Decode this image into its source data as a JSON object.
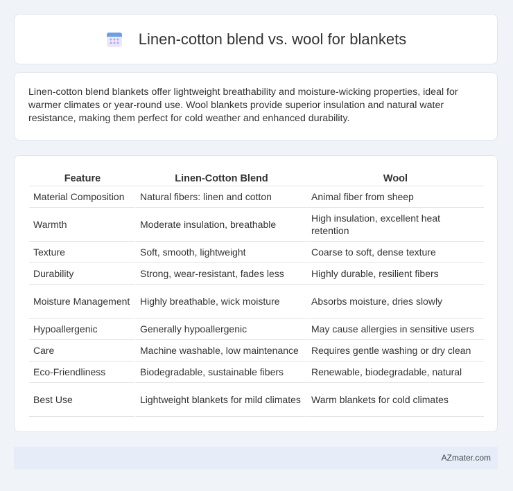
{
  "header": {
    "title": "Linen-cotton blend vs. wool for blankets",
    "icon": "calendar-icon"
  },
  "intro": {
    "text": "Linen-cotton blend blankets offer lightweight breathability and moisture-wicking properties, ideal for warmer climates or year-round use. Wool blankets provide superior insulation and natural water resistance, making them perfect for cold weather and enhanced durability."
  },
  "table": {
    "headers": [
      "Feature",
      "Linen-Cotton Blend",
      "Wool"
    ],
    "rows": [
      [
        "Material Composition",
        "Natural fibers: linen and cotton",
        "Animal fiber from sheep"
      ],
      [
        "Warmth",
        "Moderate insulation, breathable",
        "High insulation, excellent heat retention"
      ],
      [
        "Texture",
        "Soft, smooth, lightweight",
        "Coarse to soft, dense texture"
      ],
      [
        "Durability",
        "Strong, wear-resistant, fades less",
        "Highly durable, resilient fibers"
      ],
      [
        "Moisture Management",
        "Highly breathable, wick moisture",
        "Absorbs moisture, dries slowly"
      ],
      [
        "Hypoallergenic",
        "Generally hypoallergenic",
        "May cause allergies in sensitive users"
      ],
      [
        "Care",
        "Machine washable, low maintenance",
        "Requires gentle washing or dry clean"
      ],
      [
        "Eco-Friendliness",
        "Biodegradable, sustainable fibers",
        "Renewable, biodegradable, natural"
      ],
      [
        "Best Use",
        "Lightweight blankets for mild climates",
        "Warm blankets for cold climates"
      ]
    ]
  },
  "footer": {
    "text": "AZmater.com"
  },
  "colors": {
    "background": "#f0f4f9",
    "card": "#ffffff",
    "footer": "#e6edf8",
    "icon_blue": "#6aa0e8",
    "icon_purple": "#b7a4e6"
  }
}
